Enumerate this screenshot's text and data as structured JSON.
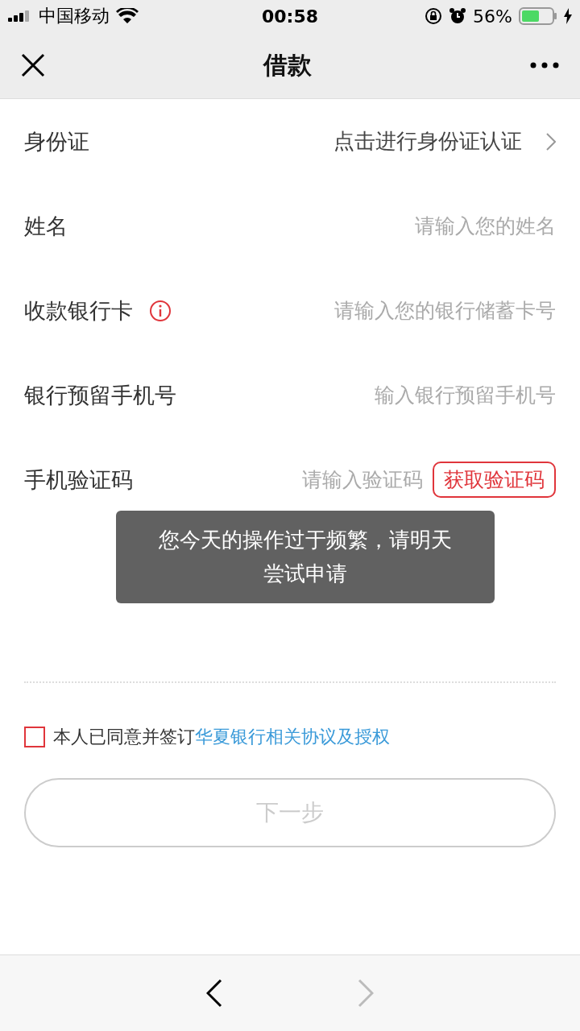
{
  "status_bar": {
    "carrier": "中国移动",
    "time": "00:58",
    "battery": "56%"
  },
  "nav": {
    "title": "借款"
  },
  "form": [
    {
      "kind": "link",
      "label": "身份证",
      "value": "点击进行身份证认证"
    },
    {
      "kind": "input",
      "label": "姓名",
      "placeholder": "请输入您的姓名"
    },
    {
      "kind": "input_info",
      "label": "收款银行卡",
      "placeholder": "请输入您的银行储蓄卡号"
    },
    {
      "kind": "input",
      "label": "银行预留手机号",
      "placeholder": "输入银行预留手机号"
    },
    {
      "kind": "code",
      "label": "手机验证码",
      "placeholder": "请输入验证码",
      "button": "获取验证码"
    }
  ],
  "agreement": {
    "checked": false,
    "text": "本人已同意并签订",
    "link": "华夏银行相关协议及授权"
  },
  "next_button": {
    "label": "下一步",
    "disabled": true
  },
  "toast": {
    "text": "您今天的操作过于频繁，请明天尝试申请"
  },
  "browser_bar": {
    "back_disabled": false,
    "forward_disabled": true
  }
}
